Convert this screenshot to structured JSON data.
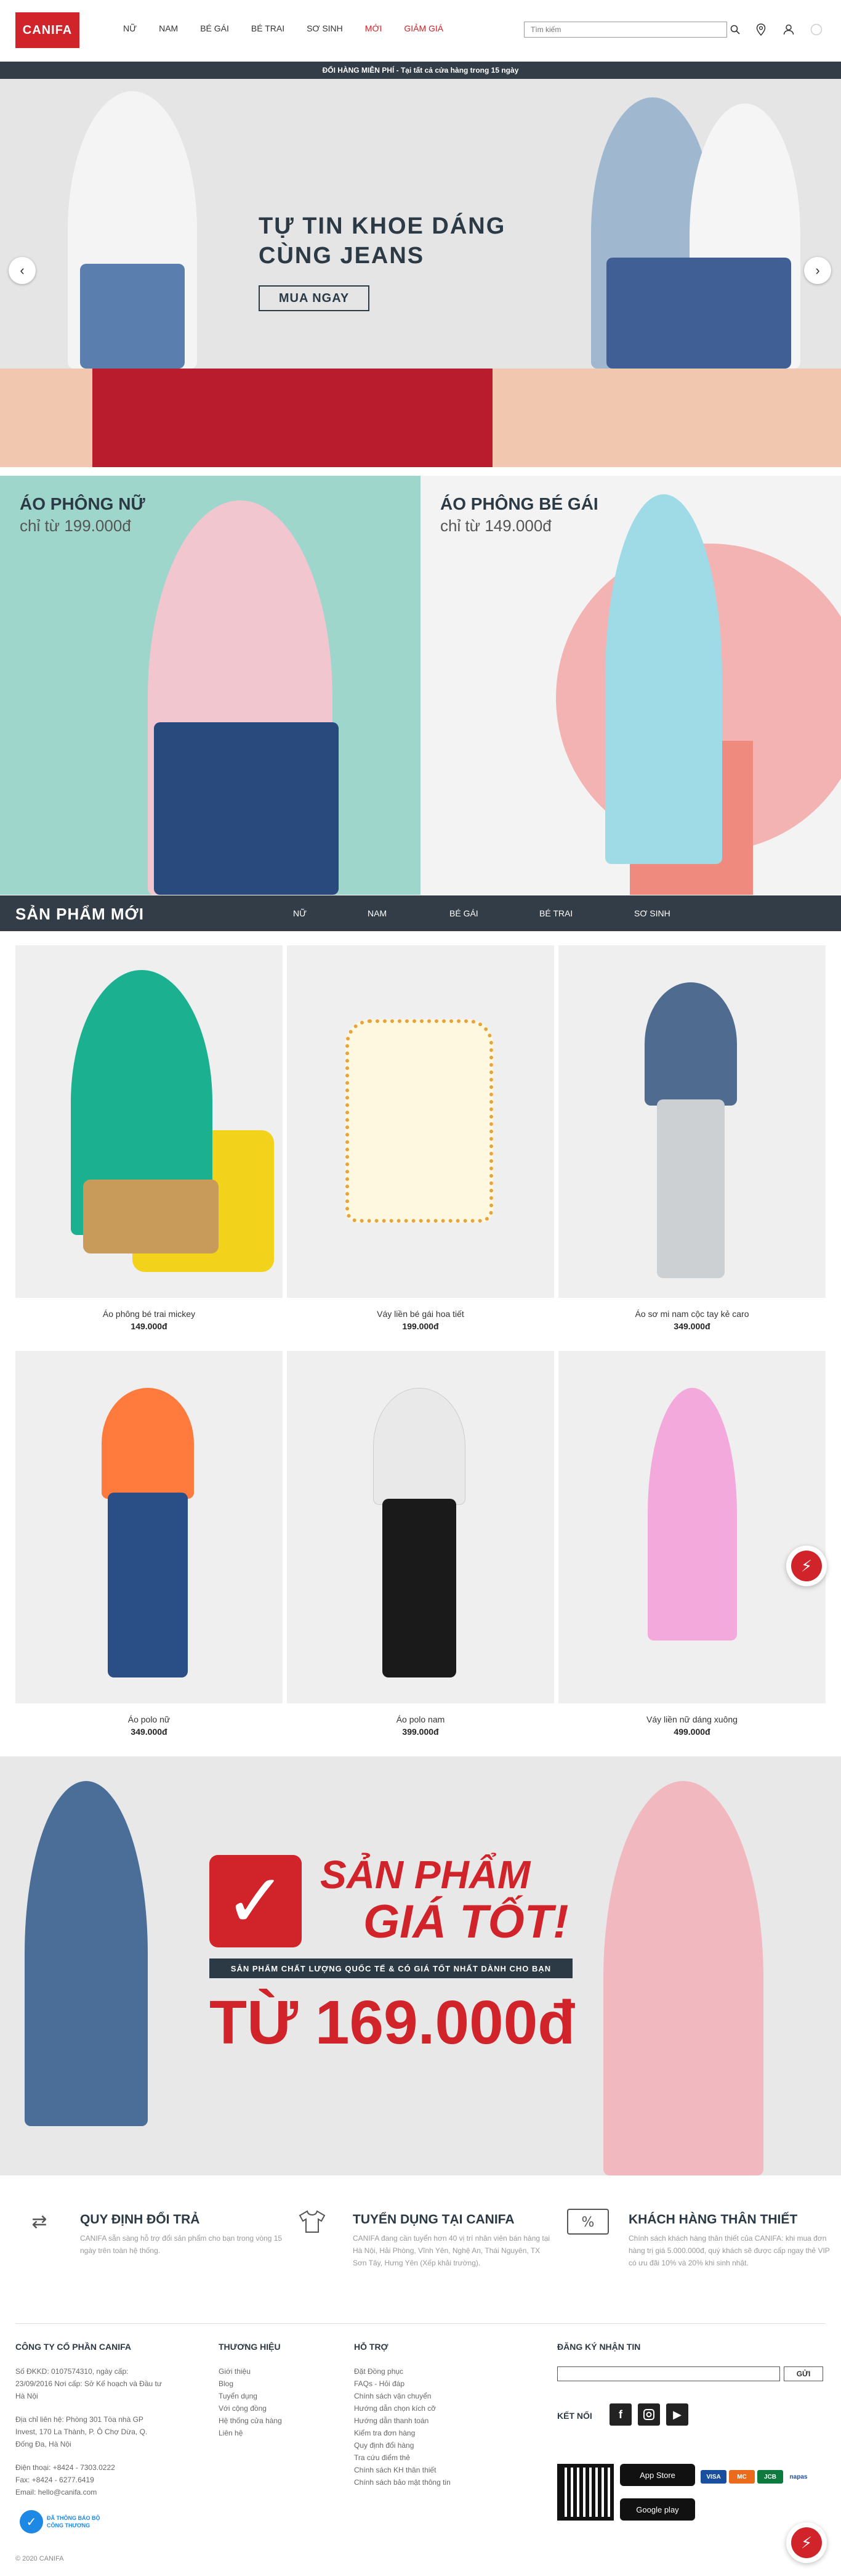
{
  "header": {
    "logo": "CANIFA",
    "nav": [
      "NỮ",
      "NAM",
      "BÉ GÁI",
      "BÉ TRAI",
      "SƠ SINH",
      "MỚI",
      "GIẢM GIÁ"
    ],
    "search_placeholder": "Tìm kiếm"
  },
  "promo_bar": {
    "text": "ĐỔI HÀNG MIỄN PHÍ - Tại tất cả cửa hàng trong 15 ngày"
  },
  "hero": {
    "title_line1": "TỰ TIN KHOE DÁNG",
    "title_line2": "CÙNG JEANS",
    "cta": "MUA NGAY"
  },
  "promos": [
    {
      "title": "ÁO PHÔNG NỮ",
      "subtitle": "chỉ từ 199.000đ"
    },
    {
      "title": "ÁO PHÔNG BÉ GÁI",
      "subtitle": "chỉ từ 149.000đ"
    }
  ],
  "new_products": {
    "title": "SẢN PHẨM MỚI",
    "tabs": [
      "NỮ",
      "NAM",
      "BÉ GÁI",
      "BÉ TRAI",
      "SƠ SINH"
    ],
    "items": [
      {
        "name": "Áo phông bé trai mickey",
        "price": "149.000đ"
      },
      {
        "name": "Váy liền bé gái hoa tiết",
        "price": "199.000đ"
      },
      {
        "name": "Áo sơ mi nam cộc tay kẻ caro",
        "price": "349.000đ"
      },
      {
        "name": "Áo polo nữ",
        "price": "349.000đ"
      },
      {
        "name": "Áo polo nam",
        "price": "399.000đ"
      },
      {
        "name": "Váy liền nữ dáng xuông",
        "price": "499.000đ"
      }
    ]
  },
  "banner": {
    "title1": "SẢN PHẨM",
    "title2": "GIÁ TỐT!",
    "strip": "SẢN PHẨM CHẤT LƯỢNG QUỐC TẾ & CÓ GIÁ TỐT NHẤT DÀNH CHO BẠN",
    "price": "TỪ 169.000đ"
  },
  "policies": [
    {
      "title": "QUY ĐỊNH ĐỔI TRẢ",
      "desc": "CANIFA sẵn sàng hỗ trợ đổi sản phẩm cho bạn trong vòng 15 ngày trên toàn hệ thống."
    },
    {
      "title": "TUYỂN DỤNG TẠI CANIFA",
      "desc": "CANIFA đang cần tuyển hơn 40 vị trí nhân viên bán hàng tại Hà Nội, Hải Phòng, Vĩnh Yên, Nghệ An, Thái Nguyên, TX Sơn Tây, Hưng Yên (Xếp khải trường)."
    },
    {
      "title": "KHÁCH HÀNG THÂN THIẾT",
      "desc": "Chính sách khách hàng thân thiết của CANIFA: khi mua đơn hàng trị giá 5.000.000đ, quý khách sẽ được cấp ngay thẻ VIP có ưu đãi 10% và 20% khi sinh nhật."
    }
  ],
  "footer": {
    "company": {
      "title": "CÔNG TY CỔ PHẦN CANIFA",
      "lines": [
        "Số ĐKKD: 0107574310, ngày cấp: 23/09/2016 Nơi cấp: Sở Kế hoạch và Đầu tư Hà Nội",
        "Địa chỉ liên hệ: Phòng 301 Tòa nhà GP Invest, 170 La Thành, P. Ô Chợ Dừa, Q. Đống Đa, Hà Nội",
        "Điện thoại: +8424 - 7303.0222",
        "Fax: +8424 - 6277.6419",
        "Email: hello@canifa.com"
      ]
    },
    "brand": {
      "title": "THƯƠNG HIỆU",
      "links": [
        "Giới thiệu",
        "Blog",
        "Tuyển dụng",
        "Với cộng đồng",
        "Hệ thống cửa hàng",
        "Liên hệ"
      ]
    },
    "support": {
      "title": "HỖ TRỢ",
      "links": [
        "Đặt Đồng phục",
        "FAQs - Hỏi đáp",
        "Chính sách vận chuyển",
        "Hướng dẫn chọn kích cỡ",
        "Hướng dẫn thanh toán",
        "Kiểm tra đơn hàng",
        "Quy định đổi hàng",
        "Tra cứu điểm thẻ",
        "Chính sách KH thân thiết",
        "Chính sách bảo mật thông tin"
      ]
    },
    "newsletter": {
      "title": "ĐĂNG KÝ NHẬN TIN",
      "button": "GỬI"
    },
    "connect": {
      "title": "KẾT NỐI"
    },
    "stores": [
      "App Store",
      "Google play"
    ],
    "payments": [
      "VISA",
      "MC",
      "JCB",
      "napas"
    ],
    "badge": "ĐÃ THÔNG BÁO BỘ CÔNG THƯƠNG",
    "copyright": "© 2020 CANIFA"
  },
  "colors": {
    "brand_red": "#d0232a",
    "dark_bar": "#333d47"
  }
}
